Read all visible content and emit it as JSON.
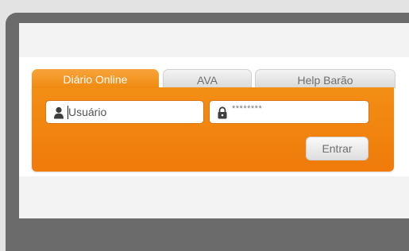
{
  "tabs": [
    {
      "label": "Diário Online",
      "active": true
    },
    {
      "label": "AVA",
      "active": false
    },
    {
      "label": "Help Barão",
      "active": false
    }
  ],
  "login": {
    "username_placeholder": "Usuário",
    "password_mask": "********",
    "submit_label": "Entrar"
  },
  "icons": {
    "username": "user-icon",
    "password": "lock-icon"
  },
  "colors": {
    "accent": "#f28a12",
    "frame": "#6b6b6b"
  }
}
